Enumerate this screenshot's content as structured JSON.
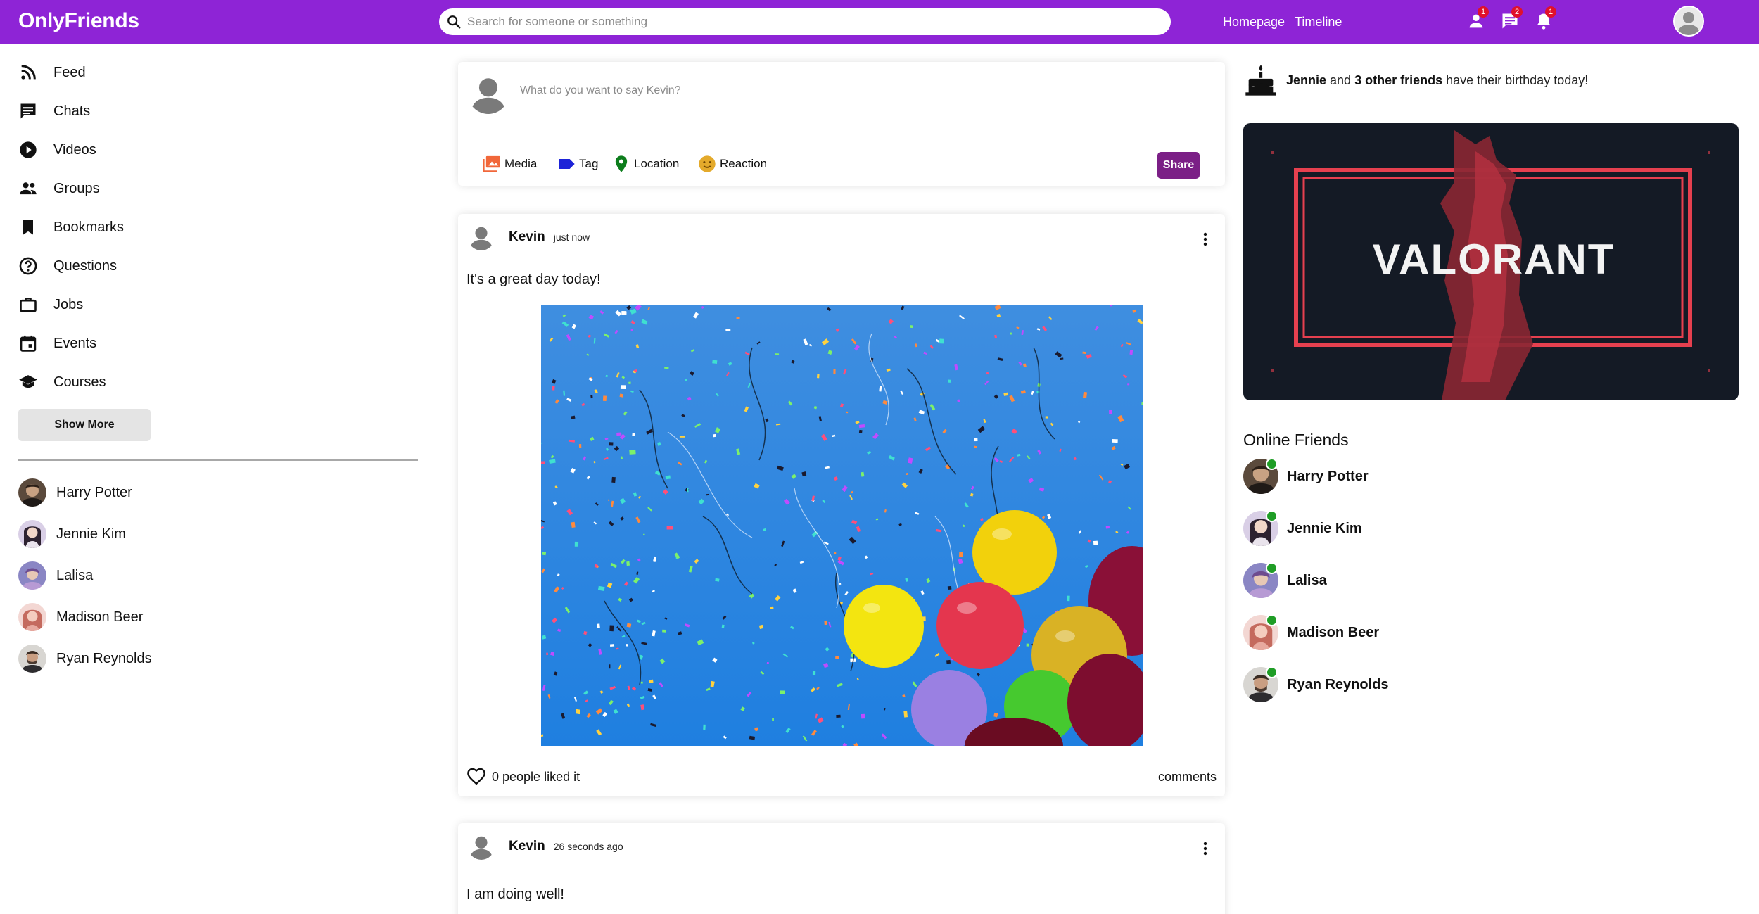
{
  "app": {
    "logo": "OnlyFriends"
  },
  "colors": {
    "brand": "#8e24d6",
    "share": "#7b1f86",
    "online": "#1f9d26",
    "badge": "#e0112b"
  },
  "topbar": {
    "search_placeholder": "Search for someone or something",
    "links": [
      "Homepage",
      "Timeline"
    ],
    "icons": [
      {
        "name": "person-icon",
        "badge": "1"
      },
      {
        "name": "chat-icon",
        "badge": "2"
      },
      {
        "name": "bell-icon",
        "badge": "1"
      }
    ]
  },
  "sidebar": {
    "items": [
      {
        "label": "Feed",
        "icon": "rss-icon"
      },
      {
        "label": "Chats",
        "icon": "chat-icon"
      },
      {
        "label": "Videos",
        "icon": "play-circle-icon"
      },
      {
        "label": "Groups",
        "icon": "group-icon"
      },
      {
        "label": "Bookmarks",
        "icon": "bookmark-icon"
      },
      {
        "label": "Questions",
        "icon": "help-circle-icon"
      },
      {
        "label": "Jobs",
        "icon": "briefcase-icon"
      },
      {
        "label": "Events",
        "icon": "calendar-icon"
      },
      {
        "label": "Courses",
        "icon": "school-icon"
      }
    ],
    "show_more": "Show More",
    "friends": [
      "Harry Potter",
      "Jennie Kim",
      "Lalisa",
      "Madison Beer",
      "Ryan Reynolds"
    ]
  },
  "composer": {
    "placeholder": "What do you want to say Kevin?",
    "options": [
      "Media",
      "Tag",
      "Location",
      "Reaction"
    ],
    "share": "Share"
  },
  "posts": [
    {
      "author": "Kevin",
      "time": "just now",
      "text": "It's a great day today!",
      "likes": "0 people liked it",
      "comments": "comments"
    },
    {
      "author": "Kevin",
      "time": "26 seconds ago",
      "text": "I am doing well!"
    }
  ],
  "birthday": {
    "name": "Jennie",
    "middle": " and ",
    "others": "3 other friends",
    "rest": " have their birthday today!"
  },
  "banner": {
    "text": "VALORANT"
  },
  "online_friends": {
    "title": "Online Friends",
    "items": [
      "Harry Potter",
      "Jennie Kim",
      "Lalisa",
      "Madison Beer",
      "Ryan Reynolds"
    ]
  }
}
